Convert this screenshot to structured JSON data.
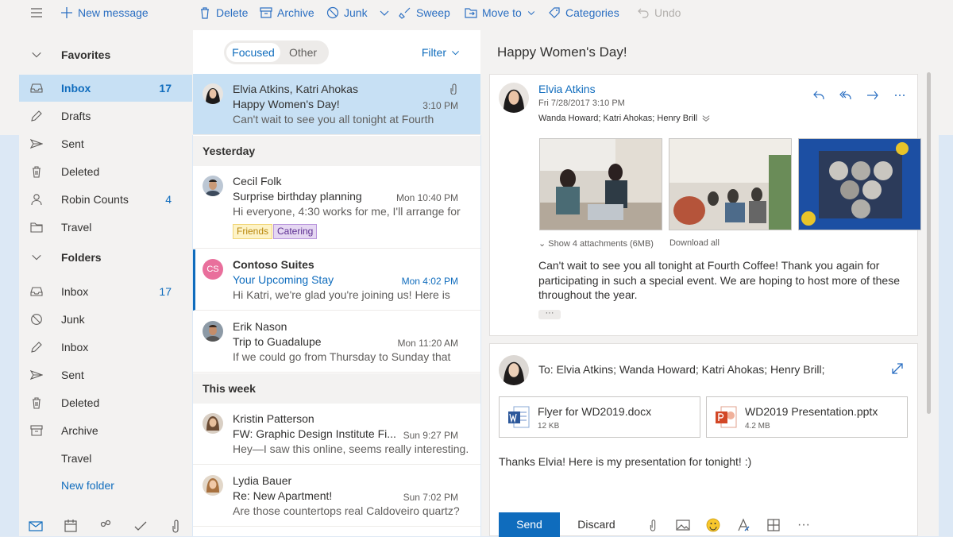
{
  "toolbar": {
    "new_message": "New message",
    "delete": "Delete",
    "archive": "Archive",
    "junk": "Junk",
    "sweep": "Sweep",
    "move_to": "Move to",
    "categories": "Categories",
    "undo": "Undo"
  },
  "nav": {
    "favorites": "Favorites",
    "folders_header": "Folders",
    "favorites_items": [
      {
        "label": "Inbox",
        "count": "17",
        "icon": "inbox-icon"
      },
      {
        "label": "Drafts",
        "count": "",
        "icon": "pencil-icon"
      },
      {
        "label": "Sent",
        "count": "",
        "icon": "send-icon"
      },
      {
        "label": "Deleted",
        "count": "",
        "icon": "trash-icon"
      },
      {
        "label": "Robin Counts",
        "count": "4",
        "icon": "person-icon"
      },
      {
        "label": "Travel",
        "count": "",
        "icon": "folder-icon"
      }
    ],
    "folder_items": [
      {
        "label": "Inbox",
        "count": "17",
        "icon": "inbox-icon"
      },
      {
        "label": "Junk",
        "count": "",
        "icon": "block-icon"
      },
      {
        "label": "Inbox",
        "count": "",
        "icon": "pencil-icon"
      },
      {
        "label": "Sent",
        "count": "",
        "icon": "send-icon"
      },
      {
        "label": "Deleted",
        "count": "",
        "icon": "trash-icon"
      },
      {
        "label": "Archive",
        "count": "",
        "icon": "archive-icon"
      },
      {
        "label": "Travel",
        "count": "",
        "icon": ""
      }
    ],
    "new_folder": "New folder"
  },
  "list": {
    "focused": "Focused",
    "other": "Other",
    "filter": "Filter",
    "groups": {
      "yesterday": "Yesterday",
      "this_week": "This week"
    },
    "messages": [
      {
        "from": "Elvia Atkins, Katri Ahokas",
        "subject": "Happy Women's Day!",
        "time": "3:10 PM",
        "preview": "Can't wait to see you all tonight at Fourth"
      },
      {
        "from": "Cecil Folk",
        "subject": "Surprise birthday planning",
        "time": "Mon 10:40 PM",
        "preview": "Hi everyone, 4:30 works for me, I'll arrange for",
        "tags": [
          "Friends",
          "Catering"
        ]
      },
      {
        "from": "Contoso Suites",
        "subject": "Your Upcoming Stay",
        "time": "Mon 4:02 PM",
        "preview": "Hi Katri, we're glad you're joining us! Here is",
        "initials": "CS"
      },
      {
        "from": "Erik Nason",
        "subject": "Trip to Guadalupe",
        "time": "Mon 11:20 AM",
        "preview": "If we could go from Thursday to Sunday that"
      },
      {
        "from": "Kristin Patterson",
        "subject": "FW: Graphic Design Institute Fi...",
        "time": "Sun 9:27 PM",
        "preview": "Hey—I saw this online, seems really interesting."
      },
      {
        "from": "Lydia Bauer",
        "subject": "Re: New Apartment!",
        "time": "Sun 7:02 PM",
        "preview": "Are those countertops real Caldoveiro quartz?"
      }
    ]
  },
  "reading": {
    "title": "Happy Women's Day!",
    "sender": "Elvia Atkins",
    "date": "Fri 7/28/2017 3:10 PM",
    "recipients": "Wanda Howard; Katri Ahokas; Henry Brill",
    "show_attachments": "Show 4 attachments (6MB)",
    "download_all": "Download all",
    "body": "Can't wait to see you all tonight at Fourth Coffee! Thank you again for participating in such a special event. We are hoping to host more of these throughout the year.",
    "more": "···"
  },
  "reply": {
    "to": "To: Elvia Atkins; Wanda Howard; Katri Ahokas; Henry Brill;",
    "files": [
      {
        "name": "Flyer for WD2019.docx",
        "size": "12 KB",
        "icon": "word-icon"
      },
      {
        "name": "WD2019 Presentation.pptx",
        "size": "4.2 MB",
        "icon": "powerpoint-icon"
      }
    ],
    "text": "Thanks Elvia! Here is my presentation for tonight! :)",
    "send": "Send",
    "discard": "Discard",
    "more": "···"
  },
  "colors": {
    "accent": "#0f6cbd",
    "selected": "#c7e0f4"
  }
}
